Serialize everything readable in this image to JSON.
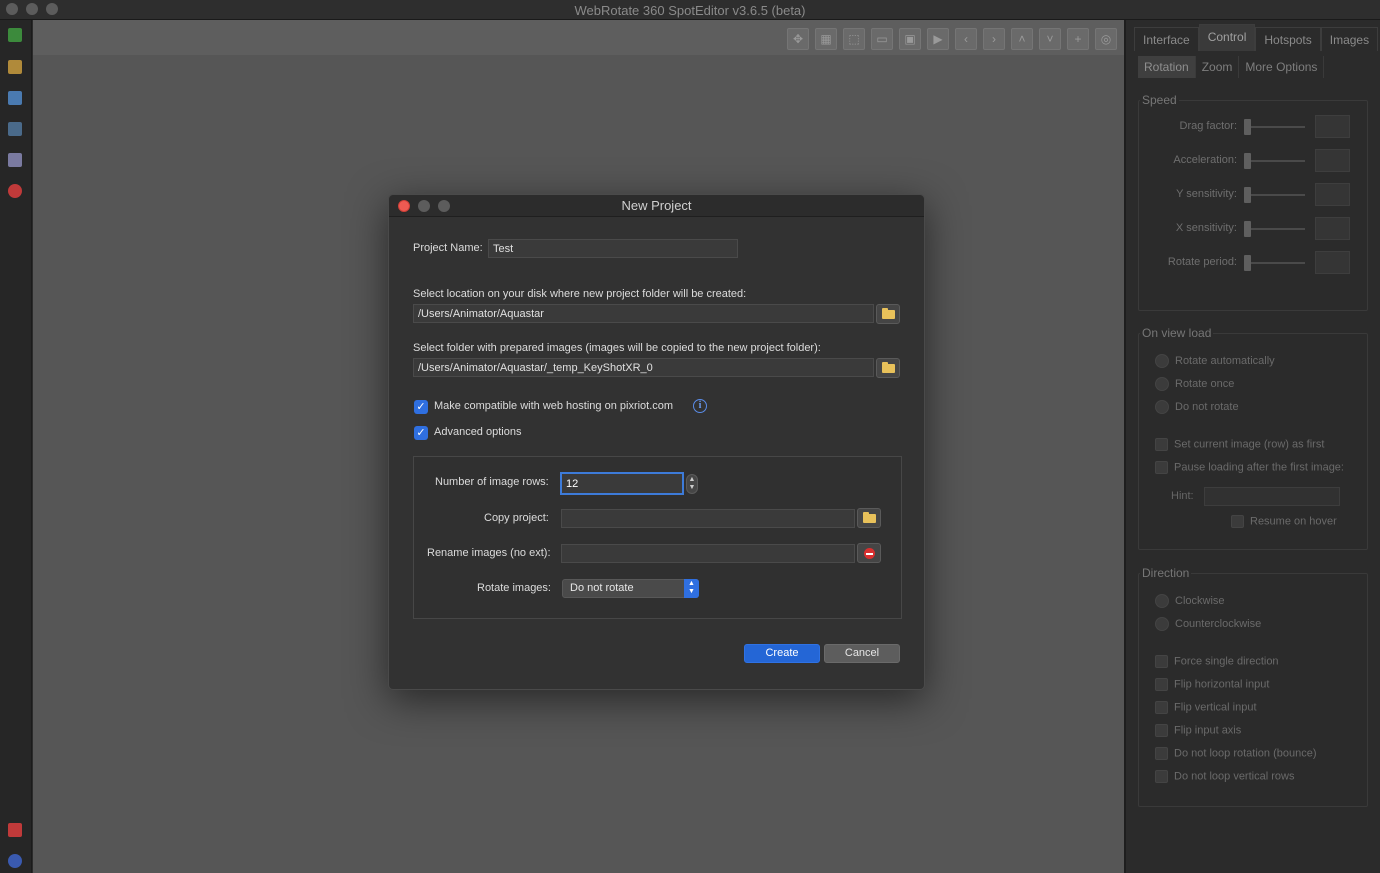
{
  "app": {
    "title": "WebRotate 360 SpotEditor v3.6.5 (beta)"
  },
  "toolbar": {
    "icons": [
      "move-icon",
      "grid-icon",
      "select-rect-icon",
      "window-icon",
      "fit-icon",
      "play-icon",
      "chevron-left-icon",
      "chevron-right-icon",
      "chevron-up-icon",
      "chevron-down-icon",
      "plus-icon",
      "target-icon"
    ]
  },
  "panel": {
    "tabs": [
      "Interface",
      "Control",
      "Hotspots",
      "Images"
    ],
    "active_tab": "Control",
    "subtabs": [
      "Rotation",
      "Zoom",
      "More Options"
    ],
    "active_subtab": "Rotation",
    "speed": {
      "title": "Speed",
      "rows": [
        "Drag factor:",
        "Acceleration:",
        "Y sensitivity:",
        "X sensitivity:",
        "Rotate period:"
      ]
    },
    "on_view_load": {
      "title": "On view load",
      "radios": [
        "Rotate automatically",
        "Rotate once",
        "Do not rotate"
      ],
      "checkboxes": [
        "Set current image (row) as first",
        "Pause loading after the first image:"
      ],
      "hint_label": "Hint:",
      "resume_label": "Resume on hover"
    },
    "direction": {
      "title": "Direction",
      "radios": [
        "Clockwise",
        "Counterclockwise"
      ],
      "checkboxes": [
        "Force single direction",
        "Flip horizontal input",
        "Flip vertical input",
        "Flip input axis",
        "Do not loop rotation (bounce)",
        "Do not loop vertical rows"
      ]
    }
  },
  "dialog": {
    "title": "New Project",
    "project_name_label": "Project Name:",
    "project_name_value": "Test",
    "location_label": "Select location on your disk where new project folder will be created:",
    "location_value": "/Users/Animator/Aquastar",
    "images_label": "Select folder with prepared images (images will be copied to the new project folder):",
    "images_value": "/Users/Animator/Aquastar/_temp_KeyShotXR_0",
    "pixriot_label": "Make compatible with web hosting on pixriot.com",
    "pixriot_checked": true,
    "advanced_label": "Advanced options",
    "advanced_checked": true,
    "rows_label": "Number of image rows:",
    "rows_value": "12",
    "copy_label": "Copy project:",
    "copy_value": "",
    "rename_label": "Rename images (no ext):",
    "rename_value": "",
    "rotate_label": "Rotate images:",
    "rotate_value": "Do not rotate",
    "create_label": "Create",
    "cancel_label": "Cancel",
    "checkmark": "✓",
    "info_glyph": "i"
  }
}
